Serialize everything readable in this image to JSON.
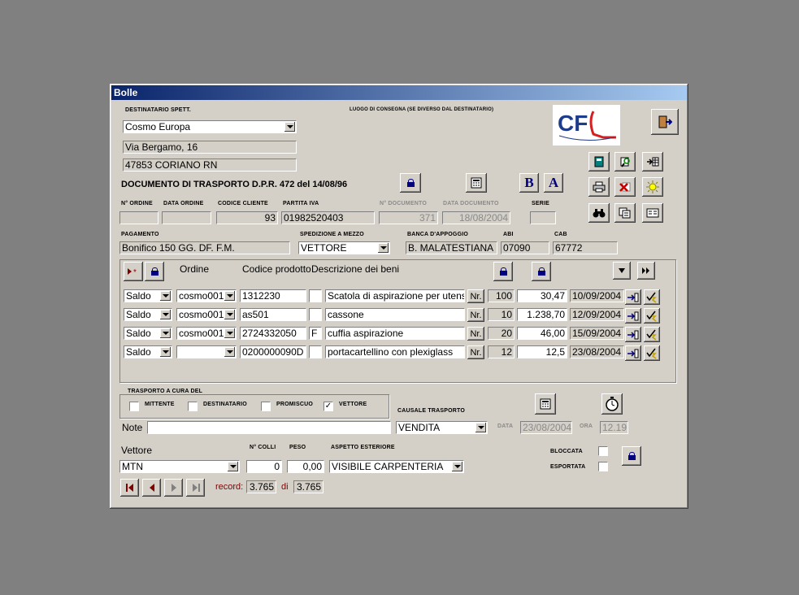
{
  "window": {
    "title": "Bolle"
  },
  "header": {
    "destinatario_label": "DESTINATARIO SPETT.",
    "destinatario": "Cosmo Europa",
    "indirizzo": "Via Bergamo, 16",
    "citta": "47853 CORIANO RN",
    "luogo_label": "LUOGO DI CONSEGNA (SE DIVERSO DAL DESTINATARIO)",
    "logo_text": "CF",
    "doc_title": "DOCUMENTO DI TRASPORTO D.P.R. 472 del 14/08/96"
  },
  "order_info": {
    "labels": {
      "n_ordine": "N° ORDINE",
      "data_ordine": "DATA ORDINE",
      "codice_cliente": "CODICE CLIENTE",
      "partita_iva": "PARTITA IVA",
      "n_documento": "N° DOCUMENTO",
      "data_documento": "DATA DOCUMENTO",
      "serie": "SERIE"
    },
    "n_ordine": "",
    "data_ordine": "",
    "codice_cliente": "93",
    "partita_iva": "01982520403",
    "n_documento": "371",
    "data_documento": "18/08/2004",
    "serie": ""
  },
  "payment": {
    "labels": {
      "pagamento": "PAGAMENTO",
      "spedizione": "SPEDIZIONE A MEZZO",
      "banca": "BANCA D'APPOGGIO",
      "abi": "ABI",
      "cab": "CAB"
    },
    "pagamento": "Bonifico 150 GG. DF. F.M.",
    "spedizione": "VETTORE",
    "banca": "B. MALATESTIANA",
    "abi": "07090",
    "cab": "67772"
  },
  "grid": {
    "headers": {
      "ordine": "Ordine",
      "codice": "Codice prodotto",
      "descrizione": "Descrizione dei beni"
    },
    "rows": [
      {
        "tipo": "Saldo",
        "ordine": "cosmo001",
        "codice": "1312230",
        "flag": "",
        "descrizione": "Scatola di aspirazione per utensile c",
        "um": "Nr.",
        "qta": "100",
        "prezzo": "30,47",
        "data": "10/09/2004"
      },
      {
        "tipo": "Saldo",
        "ordine": "cosmo001",
        "codice": "as501",
        "flag": "",
        "descrizione": "cassone",
        "um": "Nr.",
        "qta": "10",
        "prezzo": "1.238,70",
        "data": "12/09/2004"
      },
      {
        "tipo": "Saldo",
        "ordine": "cosmo001",
        "codice": "2724332050",
        "flag": "F",
        "descrizione": "cuffia aspirazione",
        "um": "Nr.",
        "qta": "20",
        "prezzo": "46,00",
        "data": "15/09/2004"
      },
      {
        "tipo": "Saldo",
        "ordine": "",
        "codice": "0200000090D",
        "flag": "",
        "descrizione": "portacartellino con plexiglass",
        "um": "Nr.",
        "qta": "12",
        "prezzo": "12,5",
        "data": "23/08/2004"
      }
    ]
  },
  "transport": {
    "label": "TRASPORTO A CURA DEL",
    "options": [
      {
        "label": "MITTENTE",
        "checked": ""
      },
      {
        "label": "DESTINATARIO",
        "checked": ""
      },
      {
        "label": "PROMISCUO",
        "checked": ""
      },
      {
        "label": "VETTORE",
        "checked": "✓"
      }
    ],
    "causale_label": "CAUSALE TRASPORTO",
    "causale": "VENDITA",
    "note_label": "Note",
    "note": "",
    "data_label": "DATA",
    "data": "23/08/2004",
    "ora_label": "ORA",
    "ora": "12.19"
  },
  "footer": {
    "vettore_label": "Vettore",
    "vettore": "MTN",
    "colli_label": "N° COLLI",
    "colli": "0",
    "peso_label": "PESO",
    "peso": "0,00",
    "aspetto_label": "ASPETTO ESTERIORE",
    "aspetto": "VISIBILE CARPENTERIA",
    "bloccata_label": "BLOCCATA",
    "esportata_label": "ESPORTATA",
    "record_label": "record:",
    "record_current": "3.765",
    "record_of": "di",
    "record_total": "3.765"
  },
  "toolbar": {
    "bold": "B",
    "font": "A"
  },
  "colors": {
    "title_start": "#0a246a",
    "title_end": "#a6caf0",
    "window_bg": "#d4d0c8",
    "desktop": "#808080",
    "logo_red": "#d42020",
    "logo_blue": "#1e3c8c"
  }
}
